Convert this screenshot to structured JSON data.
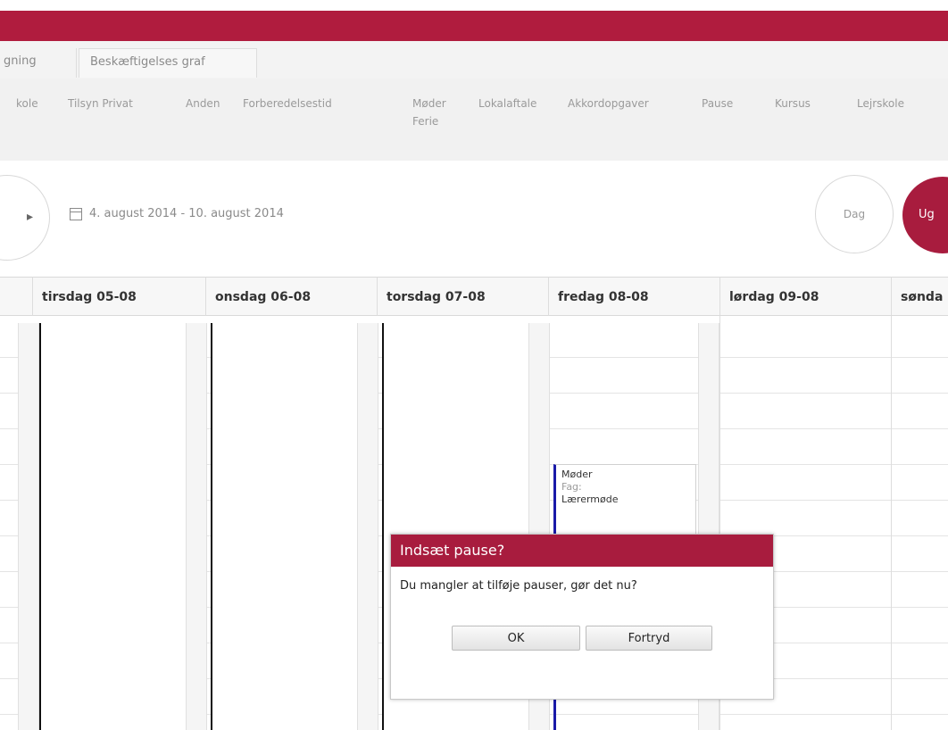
{
  "tabs": [
    "gning",
    "Beskæftigelses graf"
  ],
  "legend": {
    "items": [
      "kole",
      "Tilsyn Privat",
      "Anden",
      "Forberedelsestid",
      "Møder",
      "Lokalaftale",
      "Akkordopgaver",
      "Pause",
      "Kursus",
      "Lejrskole"
    ],
    "second_line": "Ferie"
  },
  "toolbar": {
    "date_range": "4. august 2014 - 10. august 2014",
    "view_day": "Dag",
    "view_week": "Ug"
  },
  "days": [
    "tirsdag 05-08",
    "onsdag 06-08",
    "torsdag 07-08",
    "fredag 08-08",
    "lørdag 09-08",
    "sønda"
  ],
  "event": {
    "title": "Møder",
    "subject_label": "Fag:",
    "subject_value": "Lærermøde"
  },
  "dialog": {
    "title": "Indsæt pause?",
    "message": "Du mangler at tilføje pauser, gør det nu?",
    "ok_label": "OK",
    "cancel_label": "Fortryd"
  },
  "colors": {
    "brand": "#b01c3e",
    "event_border": "#1a1aa8"
  }
}
